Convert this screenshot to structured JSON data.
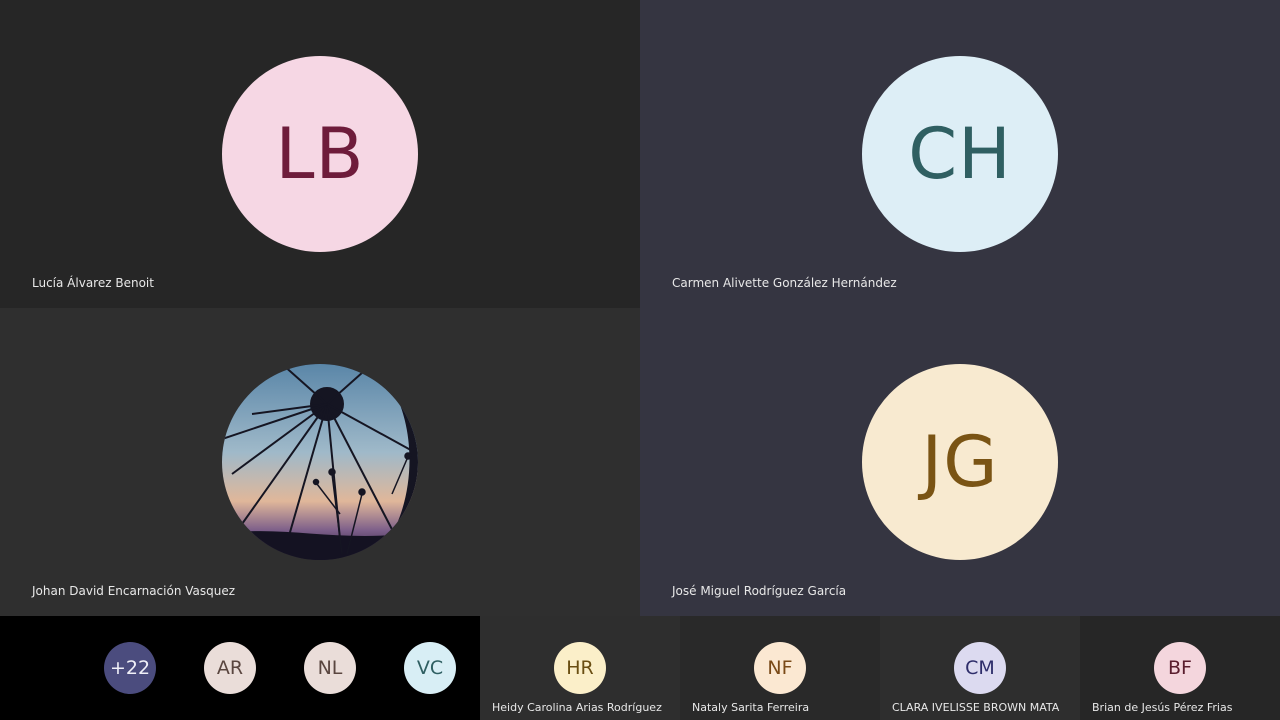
{
  "participants": [
    {
      "initials": "LB",
      "name": "Lucía Álvarez Benoit",
      "bg": "#f6d7e4",
      "fg": "#6e1c3b"
    },
    {
      "initials": "CH",
      "name": "Carmen Alivette González Hernández",
      "bg": "#ddeef6",
      "fg": "#2f5f62"
    },
    {
      "initials": "",
      "name": "Johan David Encarnación Vasquez",
      "photo": "wheel-silhouette-sunset"
    },
    {
      "initials": "JG",
      "name": "José Miguel Rodríguez García",
      "bg": "#f8ead0",
      "fg": "#7a5414"
    }
  ],
  "overflow": {
    "more_label": "+22",
    "avatars": [
      {
        "initials": "AR",
        "bg": "#eaddd9",
        "fg": "#5a4640"
      },
      {
        "initials": "NL",
        "bg": "#eaddd9",
        "fg": "#5a4640"
      },
      {
        "initials": "VC",
        "bg": "#d8eef5",
        "fg": "#2f5f62"
      }
    ]
  },
  "strip": [
    {
      "initials": "HR",
      "name": "Heidy Carolina Arias Rodríguez",
      "bg": "#fbefc9",
      "fg": "#6a4e12"
    },
    {
      "initials": "NF",
      "name": "Nataly Sarita Ferreira",
      "bg": "#fbe8d2",
      "fg": "#7a4a18"
    },
    {
      "initials": "CM",
      "name": "CLARA IVELISSE BROWN MATA",
      "bg": "#dcdaf0",
      "fg": "#2e2d6a"
    },
    {
      "initials": "BF",
      "name": "Brian de Jesús Pérez Frias",
      "bg": "#f4d6dd",
      "fg": "#5a1e2e"
    }
  ]
}
